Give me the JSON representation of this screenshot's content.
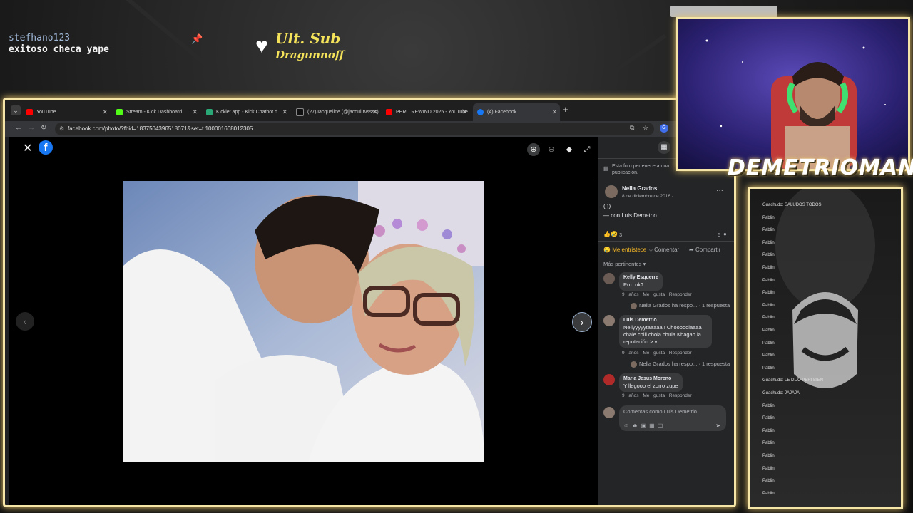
{
  "overlay": {
    "chat_user": "stefhano123",
    "chat_message": "exitoso checa yape",
    "sub_line1": "Ult. Sub",
    "sub_line2": "Dragunnoff",
    "streamer_name": "DEMETRIOMAN"
  },
  "browser": {
    "tabs": [
      {
        "label": "YouTube",
        "icon_color": "#ff0000"
      },
      {
        "label": "Stream - Kick Dashboard",
        "icon_color": "#53fc18"
      },
      {
        "label": "Kicklet.app - Kick Chatbot d",
        "icon_color": "#2aa876"
      },
      {
        "label": "(27)Jacqueline (@jacqui.rvssss)",
        "icon_color": "#111111"
      },
      {
        "label": "PERU REWIND 2025 - YouTube",
        "icon_color": "#ff0000"
      },
      {
        "label": "(4) Facebook",
        "icon_color": "#1877f2"
      }
    ],
    "url": "facebook.com/photo/?fbid=1837504396518071&set=t.100001668012305",
    "profile_initial": "G"
  },
  "panel": {
    "notice": "Esta foto pertenece a una publicación.",
    "author": "Nella Grados",
    "date": "8 de diciembre de 2016 · ",
    "emoji": "(ʃƪ)",
    "with_text": "— con Luis Demetrio.",
    "reaction_count": "3",
    "comment_count": "5",
    "actions": {
      "react": "Me entristece",
      "comment": "Comentar",
      "share": "Compartir"
    },
    "sort_label": "Más pertinentes",
    "comments": [
      {
        "author": "Kelly Esquerre",
        "text": "Prro ok?",
        "meta": "9 años  Me gusta  Responder",
        "reply": "Nella Grados ha respo... · 1 respuesta"
      },
      {
        "author": "Luis Demetrio",
        "text": "Nellyyyyytaaaaa!! Chooooolaaaa chale chili chola chula Khagao la reputación >:v",
        "meta": "9 años  Me gusta  Responder",
        "reply": "Nella Grados ha respo... · 1 respuesta"
      },
      {
        "author": "Maria Jesus Moreno",
        "text": "Y llegooo el zorro zupe",
        "meta": "9 años  Me gusta  Responder",
        "reply": ""
      }
    ],
    "composer_placeholder": "Comentas como Luis Demetrio"
  },
  "stream_chat": [
    "Guachudo: SALUDOS TODOS",
    "Pablini",
    "Pablini",
    "Pablini",
    "Pablini",
    "Pablini",
    "Pablini",
    "Pablini",
    "Pablini",
    "Pablini",
    "Pablini",
    "Pablini",
    "Pablini",
    "Pablini",
    "Guachudo: LE DIJO PERI BIEN",
    "Guachudo: JAJAJA",
    "Pablini",
    "Pablini",
    "Pablini",
    "Pablini",
    "Pablini",
    "Pablini",
    "Pablini",
    "Pablini"
  ]
}
